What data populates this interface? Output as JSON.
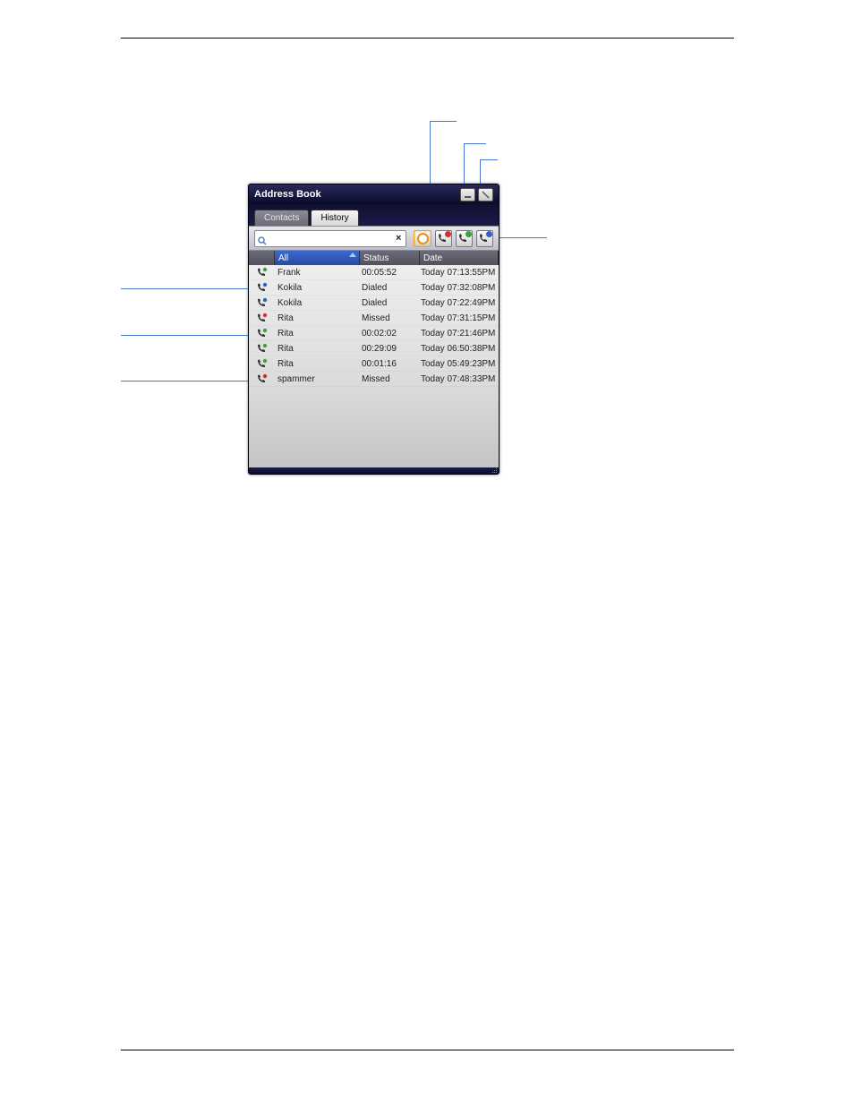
{
  "window": {
    "title": "Address Book"
  },
  "tabs": {
    "contacts": "Contacts",
    "history": "History"
  },
  "search": {
    "value": "",
    "placeholder": ""
  },
  "filters": {
    "all_name": "filter-all",
    "missed_name": "filter-missed",
    "received_name": "filter-received",
    "dialed_name": "filter-dialed"
  },
  "headers": {
    "name": "All",
    "status": "Status",
    "date": "Date"
  },
  "rows": [
    {
      "icon": "received",
      "name": "Frank",
      "status": "00:05:52",
      "date": "Today 07:13:55PM"
    },
    {
      "icon": "dialed",
      "name": "Kokila",
      "status": "Dialed",
      "date": "Today 07:32:08PM"
    },
    {
      "icon": "dialed",
      "name": "Kokila",
      "status": "Dialed",
      "date": "Today 07:22:49PM"
    },
    {
      "icon": "missed",
      "name": "Rita",
      "status": "Missed",
      "date": "Today 07:31:15PM"
    },
    {
      "icon": "received",
      "name": "Rita",
      "status": "00:02:02",
      "date": "Today 07:21:46PM"
    },
    {
      "icon": "received",
      "name": "Rita",
      "status": "00:29:09",
      "date": "Today 06:50:38PM"
    },
    {
      "icon": "received",
      "name": "Rita",
      "status": "00:01:16",
      "date": "Today 05:49:23PM"
    },
    {
      "icon": "missed",
      "name": "spammer",
      "status": "Missed",
      "date": "Today 07:48:33PM"
    }
  ]
}
